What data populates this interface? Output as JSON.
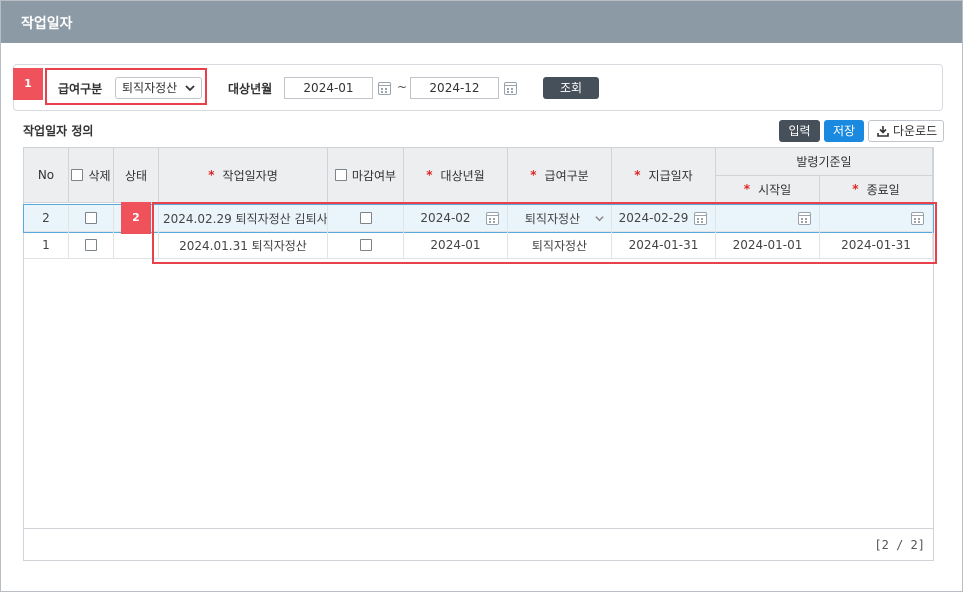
{
  "window": {
    "title": "작업일자"
  },
  "annotations": {
    "marker1": "1",
    "marker2": "2",
    "highlight_color": "#e8414c"
  },
  "search": {
    "pay_type_label": "급여구분",
    "pay_type_value": "퇴직자정산",
    "period_label": "대상년월",
    "from": "2024-01",
    "to": "2024-12",
    "range_sep": "~",
    "search_button": "조회"
  },
  "section": {
    "title": "작업일자 정의",
    "buttons": {
      "add": "입력",
      "save": "저장",
      "download": "다운로드"
    }
  },
  "grid": {
    "columns": {
      "no": "No",
      "delete": "삭제",
      "status": "상태",
      "name": "작업일자명",
      "closed": "마감여부",
      "target_month": "대상년월",
      "pay_type": "급여구분",
      "pay_date": "지급일자",
      "base_group": "발령기준일",
      "start": "시작일",
      "end": "종료일"
    },
    "required_mark": "*",
    "rows": [
      {
        "no": "2",
        "name": "2024.02.29 퇴직자정산 김퇴사",
        "target_month": "2024-02",
        "pay_type": "퇴직자정산",
        "pay_date": "2024-02-29",
        "start": "",
        "end": ""
      },
      {
        "no": "1",
        "name": "2024.01.31 퇴직자정산",
        "target_month": "2024-01",
        "pay_type": "퇴직자정산",
        "pay_date": "2024-01-31",
        "start": "2024-01-01",
        "end": "2024-01-31"
      }
    ],
    "pager": "[2 / 2]"
  },
  "colors": {
    "titlebar": "#8c9aa6",
    "primary_button": "#1a8ae0",
    "dark_button": "#46505b",
    "required": "#e02424",
    "selected_row": "#eaf4fb"
  },
  "icons": [
    "calendar-icon",
    "chevron-down-icon",
    "download-icon",
    "checkbox-icon"
  ]
}
